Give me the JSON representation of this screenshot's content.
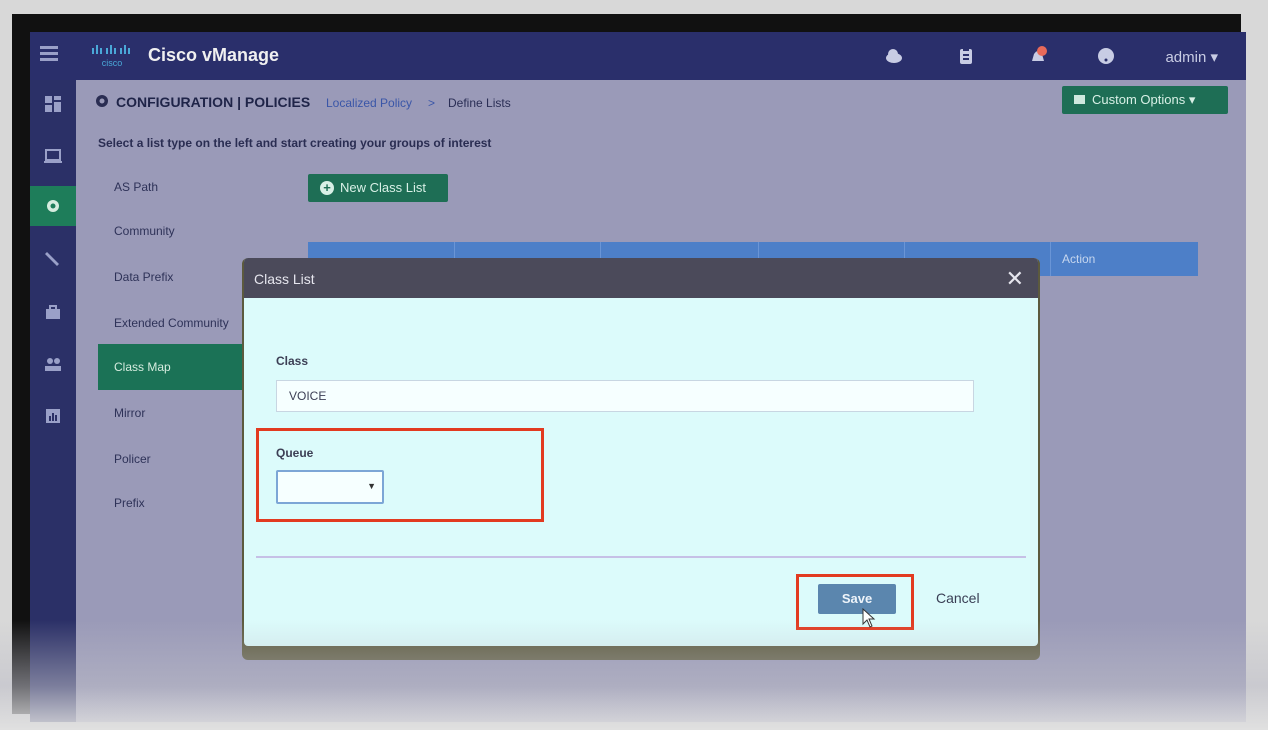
{
  "app": {
    "title": "Cisco vManage",
    "user": "admin ▾"
  },
  "topbar_icons": [
    "cloud-icon",
    "clipboard-icon",
    "bell-icon",
    "help-icon"
  ],
  "nav_icons": [
    "dashboard-icon",
    "monitor-icon",
    "settings-icon",
    "wrench-icon",
    "toolbox-icon",
    "users-icon",
    "analytics-icon"
  ],
  "header": {
    "section": "CONFIGURATION | POLICIES",
    "breadcrumb_1": "Localized Policy",
    "breadcrumb_sep": ">",
    "breadcrumb_2": "Define Lists",
    "custom_options": "Custom Options ▾"
  },
  "subtitle": "Select a list type on the left and start creating your groups of interest",
  "list_types": [
    "AS Path",
    "Community",
    "Data Prefix",
    "Extended Community",
    "Class Map",
    "Mirror",
    "Policer",
    "Prefix"
  ],
  "active_list_type": "Class Map",
  "new_class_button": "New Class List",
  "table": {
    "action_header": "Action"
  },
  "modal": {
    "title": "Class List",
    "close": "✕",
    "class_label": "Class",
    "class_value": "VOICE",
    "queue_label": "Queue",
    "queue_value": "",
    "save": "Save",
    "cancel": "Cancel"
  },
  "colors": {
    "topbar": "#2a2f6b",
    "accent_green": "#1e6e55",
    "highlight_red": "#e23a20",
    "modal_bg": "#dcfbfb"
  }
}
